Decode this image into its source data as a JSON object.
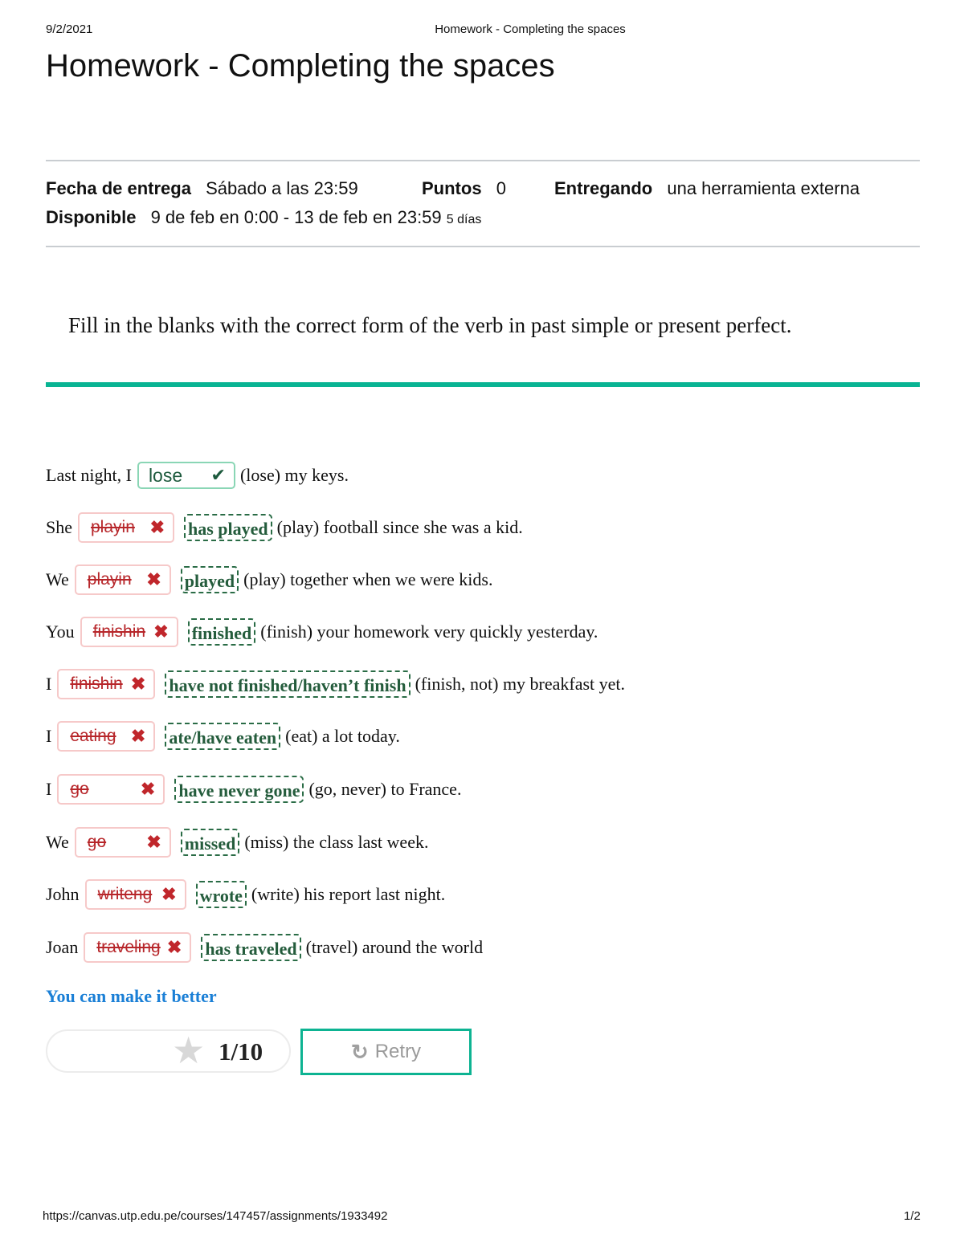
{
  "print_header": {
    "date": "9/2/2021",
    "title": "Homework - Completing the spaces"
  },
  "page_title": "Homework - Completing the spaces",
  "details": {
    "due_label": "Fecha de entrega",
    "due_value": "Sábado a las 23:59",
    "points_label": "Puntos",
    "points_value": "0",
    "submitting_label": "Entregando",
    "submitting_value": "una herramienta externa",
    "available_label": "Disponible",
    "available_value": "9 de feb en 0:00 - 13 de feb en 23:59",
    "available_days": "5 días"
  },
  "instruction": "Fill in the blanks with the correct form of the verb in past simple or present perfect.",
  "exercises": [
    {
      "prefix": "Last night, I",
      "answer": "lose",
      "status": "correct",
      "correction": "",
      "rest": "(lose) my keys."
    },
    {
      "prefix": "She",
      "answer": "playin",
      "status": "wrong",
      "correction": "has played",
      "rest": "(play) football since she was a kid."
    },
    {
      "prefix": "We",
      "answer": "playin",
      "status": "wrong",
      "correction": "played",
      "rest": "(play) together when we were kids."
    },
    {
      "prefix": "You",
      "answer": "finishin",
      "status": "wrong",
      "correction": "finished",
      "rest": "(finish) your homework very quickly yesterday."
    },
    {
      "prefix": "I",
      "answer": "finishin",
      "status": "wrong",
      "correction": "have not finished/haven’t finish",
      "rest": "(finish, not) my breakfast yet."
    },
    {
      "prefix": "I",
      "answer": "eating",
      "status": "wrong",
      "correction": "ate/have eaten",
      "rest": "(eat) a lot today."
    },
    {
      "prefix": "I",
      "answer": "go",
      "status": "wrong",
      "correction": "have never gone",
      "rest": "(go, never) to France."
    },
    {
      "prefix": "We",
      "answer": "go",
      "status": "wrong",
      "correction": "missed",
      "rest": "(miss) the class last week."
    },
    {
      "prefix": "John",
      "answer": "writeng",
      "status": "wrong",
      "correction": "wrote",
      "rest": "(write) his report last night."
    },
    {
      "prefix": "Joan",
      "answer": "traveling",
      "status": "wrong",
      "correction": "has traveled",
      "rest": "(travel) around the world"
    }
  ],
  "icons": {
    "correct": "✔",
    "wrong": "✖",
    "star": "★",
    "retry": "↻"
  },
  "feedback": "You can make it better",
  "score": {
    "value": "1/10",
    "correct_count": 1,
    "total": 10
  },
  "retry_label": "Retry",
  "colors": {
    "accent": "#09b493",
    "correct_green": "#245c3c",
    "wrong_red": "#c0262b",
    "feedback_blue": "#1a7fd6"
  },
  "print_footer": {
    "url": "https://canvas.utp.edu.pe/courses/147457/assignments/1933492",
    "page": "1/2"
  }
}
